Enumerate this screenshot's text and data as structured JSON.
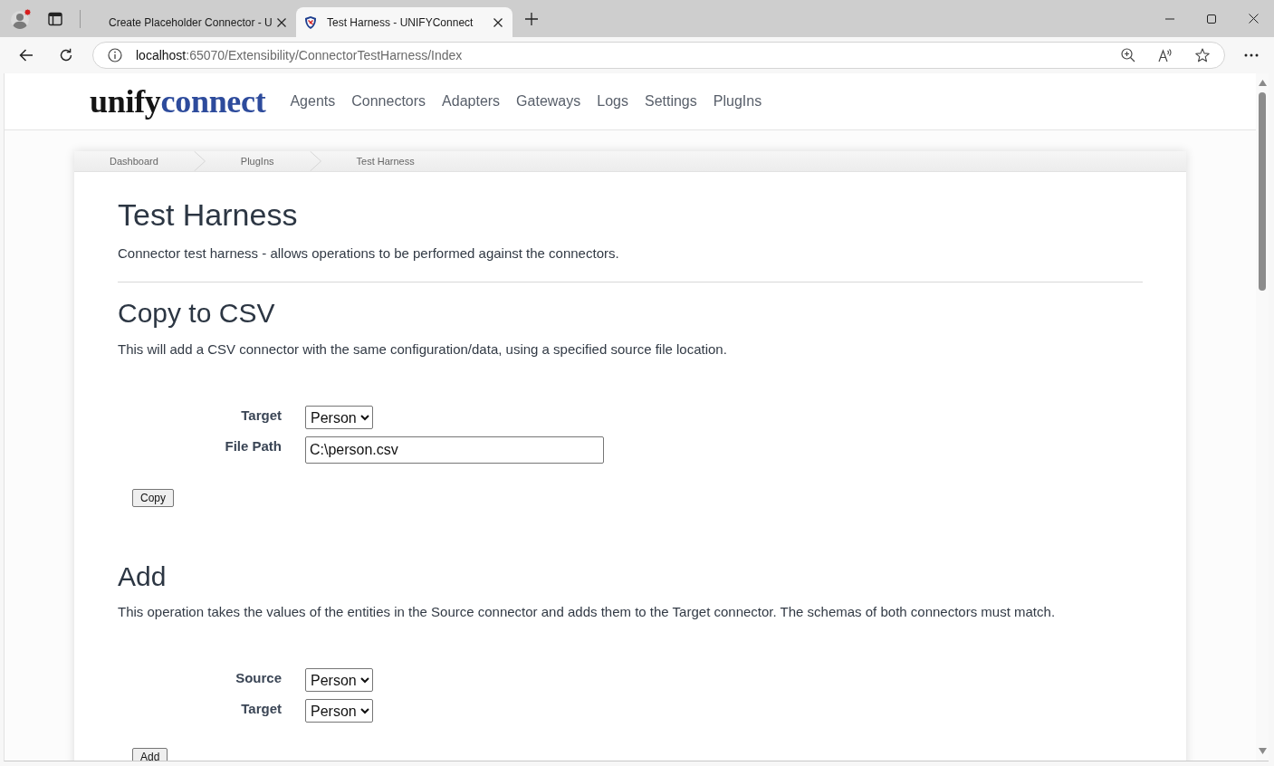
{
  "browser": {
    "tabs": [
      {
        "title": "Create Placeholder Connector - U",
        "selected": false
      },
      {
        "title": "Test Harness - UNIFYConnect",
        "selected": true
      }
    ],
    "address_bar": {
      "host": "localhost",
      "path": ":65070/Extensibility/ConnectorTestHarness/Index"
    }
  },
  "navbar": {
    "logo": [
      {
        "text": "unify",
        "color": "#141414"
      },
      {
        "text": "connect",
        "color": "#2d4b9c"
      }
    ],
    "links": [
      "Agents",
      "Connectors",
      "Adapters",
      "Gateways",
      "Logs",
      "Settings",
      "PlugIns"
    ]
  },
  "breadcrumb": [
    "Dashboard",
    "PlugIns",
    "Test Harness"
  ],
  "page": {
    "title": "Test Harness",
    "description": "Connector test harness - allows operations to be performed against the connectors."
  },
  "sections": [
    {
      "heading": "Copy to CSV",
      "description": "This will add a CSV connector with the same configuration/data, using a specified source file location.",
      "fields": [
        {
          "kind": "select",
          "label": "Target",
          "value": "Person"
        },
        {
          "kind": "text",
          "label": "File Path",
          "value": "C:\\person.csv"
        }
      ],
      "button": "Copy"
    },
    {
      "heading": "Add",
      "description": "This operation takes the values of the entities in the Source connector and adds them to the Target connector. The schemas of both connectors must match.",
      "fields": [
        {
          "kind": "select",
          "label": "Source",
          "value": "Person"
        },
        {
          "kind": "select",
          "label": "Target",
          "value": "Person"
        }
      ],
      "button": "Add"
    }
  ]
}
